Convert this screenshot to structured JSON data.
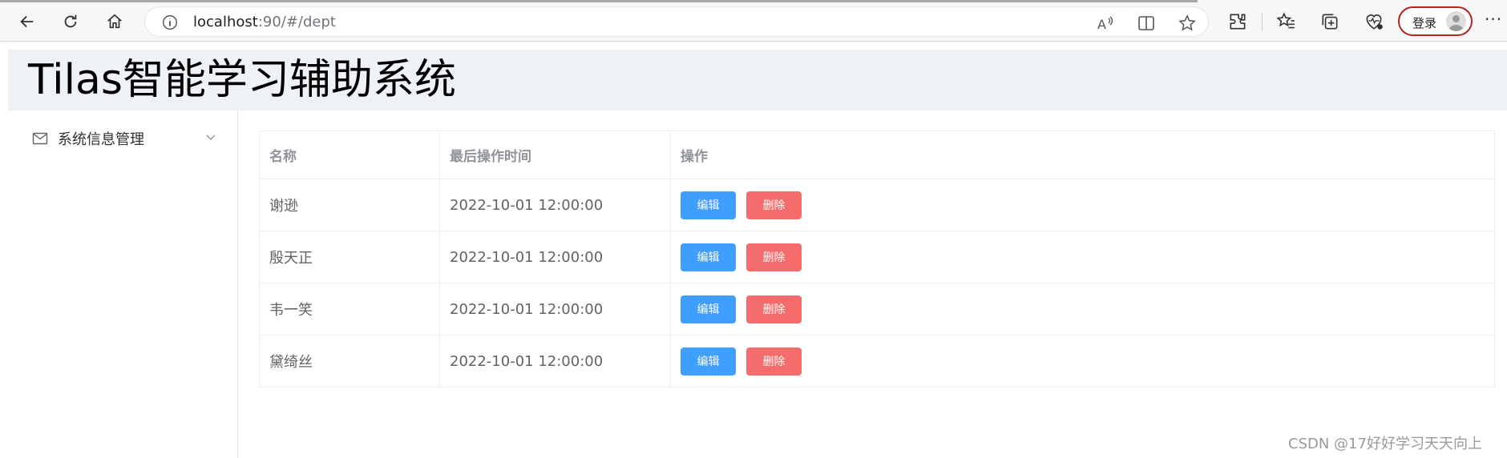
{
  "browser": {
    "url_host": "localhost",
    "url_rest": ":90/#/dept",
    "login_label": "登录"
  },
  "app": {
    "title": "Tilas智能学习辅助系统"
  },
  "sidebar": {
    "items": [
      {
        "label": "系统信息管理",
        "icon": "mail-icon"
      }
    ]
  },
  "table": {
    "headers": [
      "名称",
      "最后操作时间",
      "操作"
    ],
    "rows": [
      {
        "name": "谢逊",
        "time": "2022-10-01 12:00:00"
      },
      {
        "name": "殷天正",
        "time": "2022-10-01 12:00:00"
      },
      {
        "name": "韦一笑",
        "time": "2022-10-01 12:00:00"
      },
      {
        "name": "黛绮丝",
        "time": "2022-10-01 12:00:00"
      }
    ],
    "edit_label": "编辑",
    "delete_label": "删除"
  },
  "watermark": "CSDN @17好好学习天天向上",
  "colors": {
    "edit": "#409eff",
    "delete": "#f56c6c",
    "header_bg": "#eef1f6"
  }
}
